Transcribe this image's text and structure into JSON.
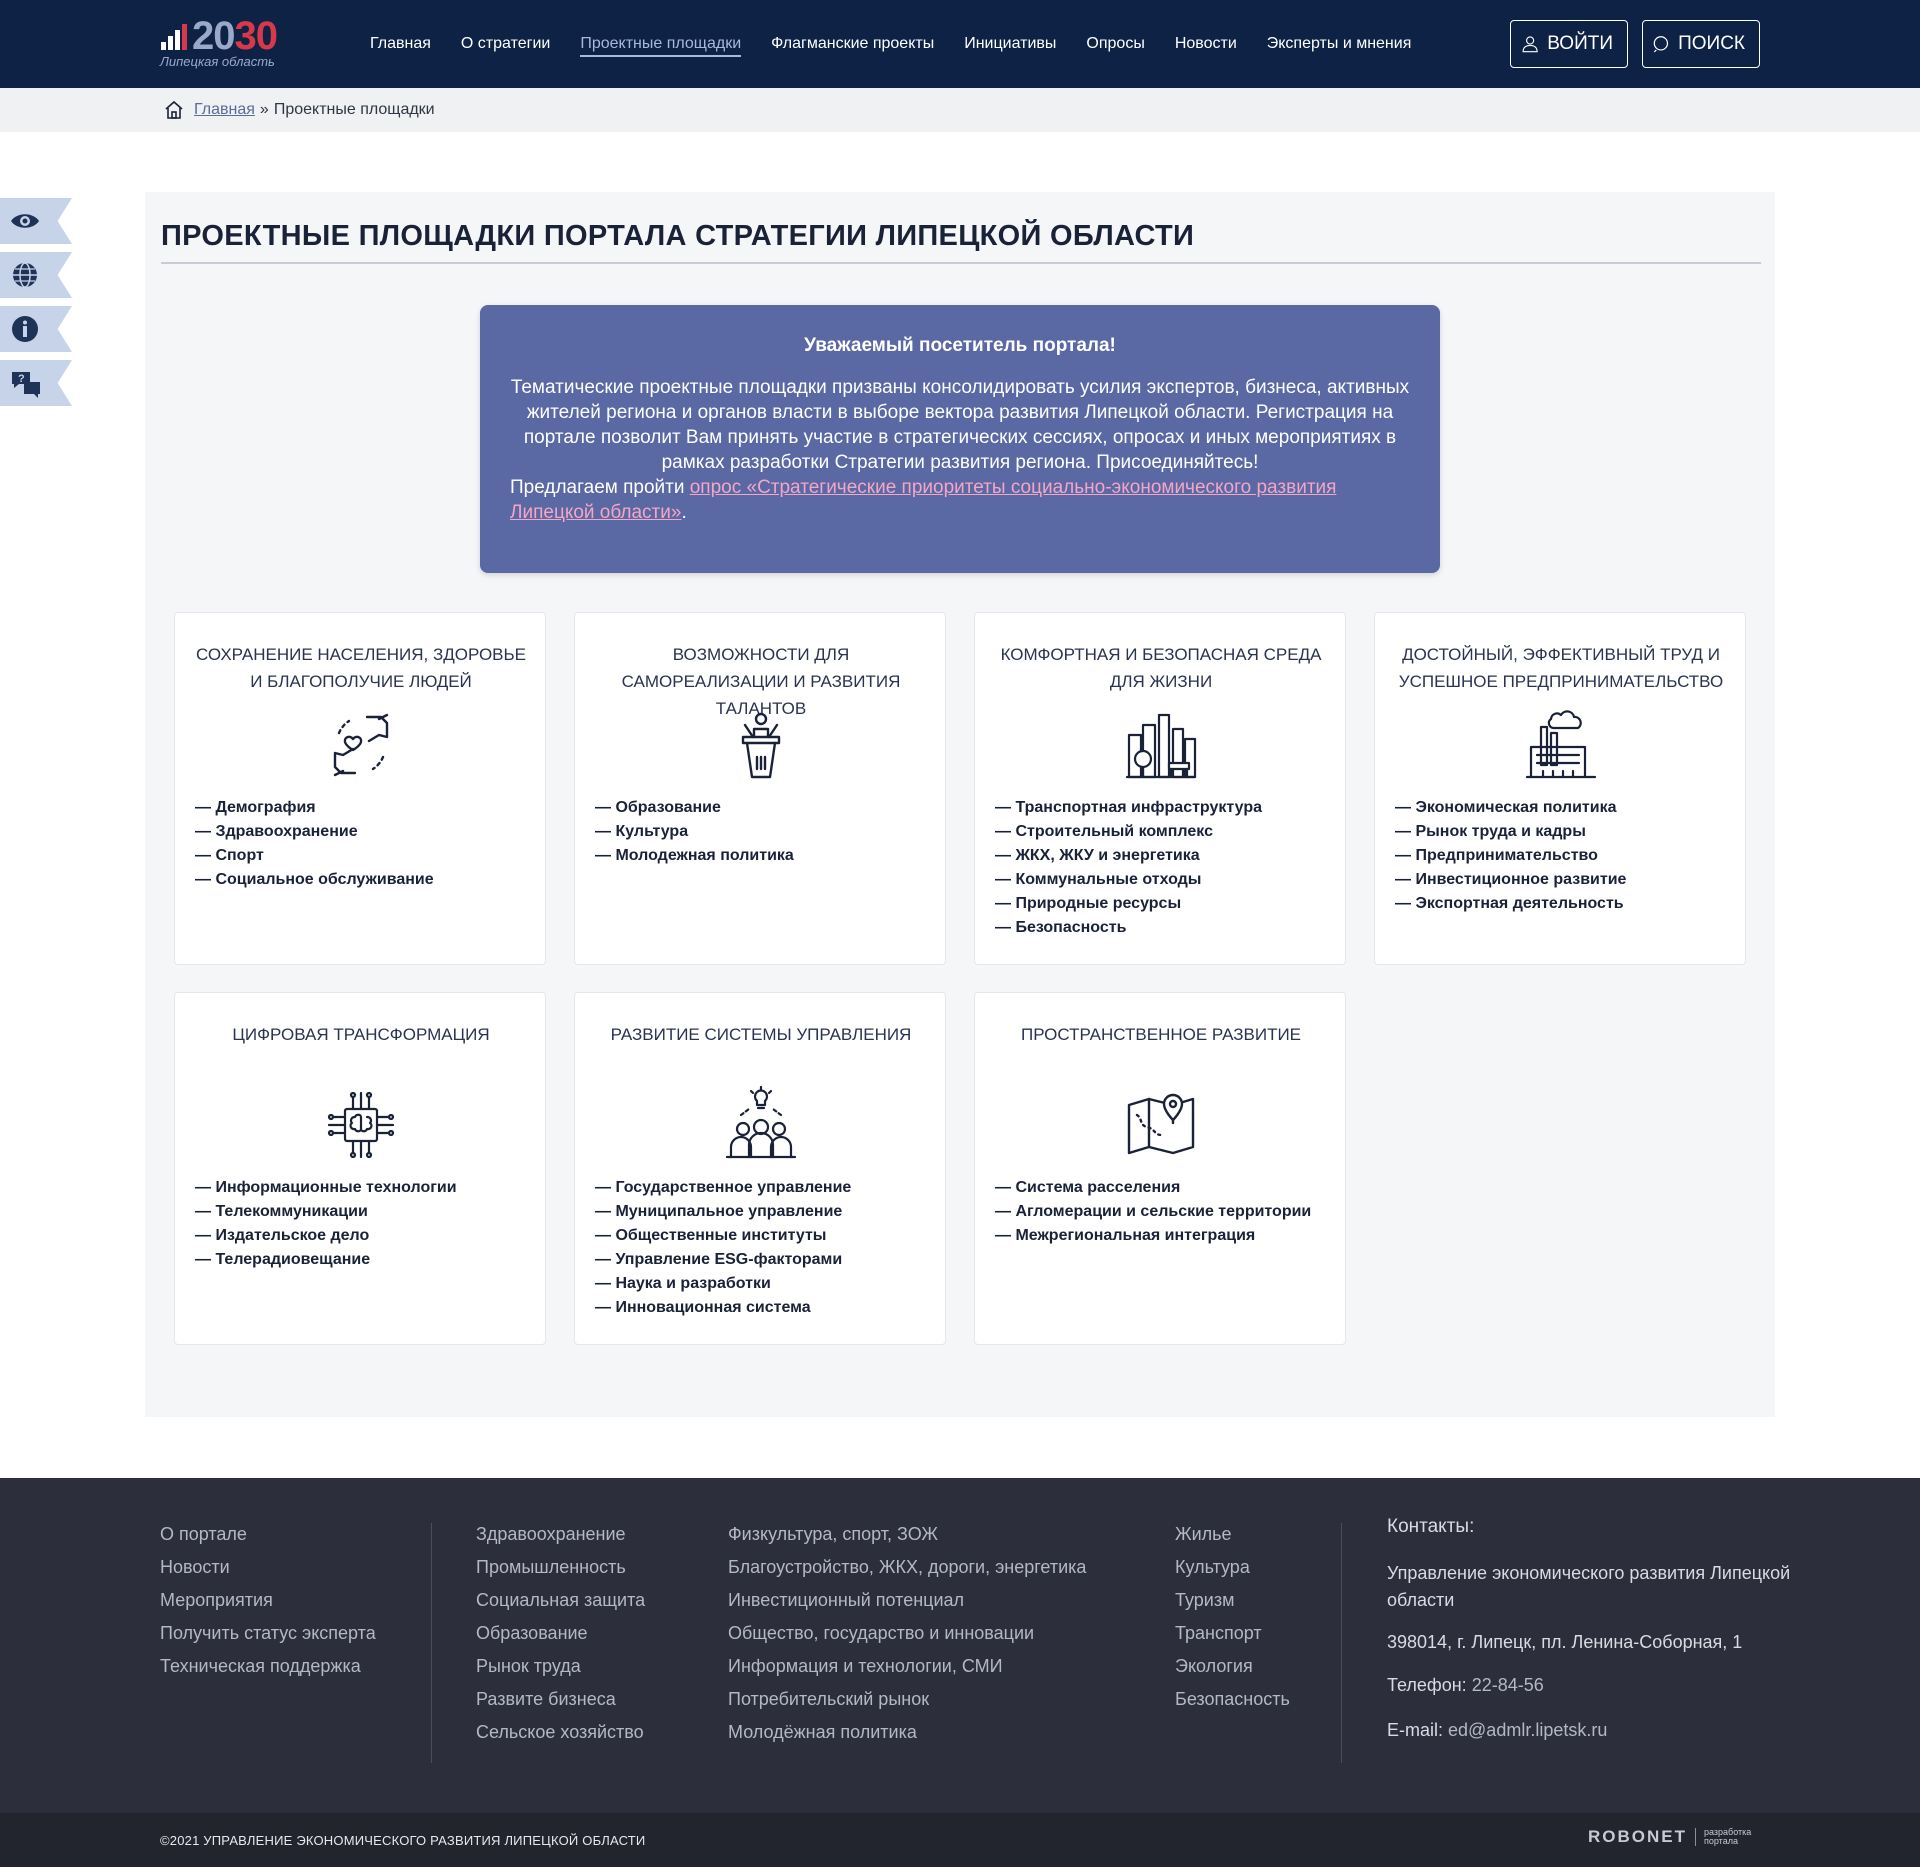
{
  "header": {
    "logo_year_a": "20",
    "logo_year_b": "30",
    "logo_sub": "Липецкая область",
    "nav": [
      {
        "label": "Главная"
      },
      {
        "label": "О стратегии"
      },
      {
        "label": "Проектные площадки"
      },
      {
        "label": "Флагманские проекты"
      },
      {
        "label": "Инициативы"
      },
      {
        "label": "Опросы"
      },
      {
        "label": "Новости"
      },
      {
        "label": "Эксперты и мнения"
      }
    ],
    "active_nav": "Проектные площадки",
    "login_label": "ВОЙТИ",
    "search_label": "ПОИСК"
  },
  "breadcrumb": {
    "home_label": "Главная",
    "separator": "»",
    "current": "Проектные площадки"
  },
  "side_tools": [
    "eye-icon",
    "globe-icon",
    "info-icon",
    "chat-question-icon"
  ],
  "page": {
    "title": "ПРОЕКТНЫЕ ПЛОЩАДКИ ПОРТАЛА СТРАТЕГИИ ЛИПЕЦКОЙ ОБЛАСТИ"
  },
  "notice": {
    "heading": "Уважаемый посетитель портала!",
    "body": "Тематические проектные площадки призваны консолидировать усилия экспертов, бизнеса, активных жителей региона и органов власти в выборе вектора развития Липецкой области. Регистрация на портале позволит Вам принять участие в стратегических сессиях, опросах и иных мероприятиях в рамках разработки Стратегии развития региона. Присоединяйтесь!",
    "cta_prefix": "Предлагаем пройти ",
    "cta_link": "опрос «Стратегические приоритеты социально-экономического развития Липецкой области»",
    "cta_suffix": "."
  },
  "cards": [
    {
      "title": "СОХРАНЕНИЕ НАСЕЛЕНИЯ, ЗДОРОВЬЕ И БЛАГОПОЛУЧИЕ ЛЮДЕЙ",
      "icon": "hands-heart-icon",
      "items": [
        "— Демография",
        "— Здравоохранение",
        "— Спорт",
        "— Социальное обслуживание"
      ]
    },
    {
      "title": "ВОЗМОЖНОСТИ ДЛЯ САМОРЕАЛИЗАЦИИ И РАЗВИТИЯ ТАЛАНТОВ",
      "icon": "speaker-podium-icon",
      "items": [
        "— Образование",
        "— Культура",
        "— Молодежная политика"
      ]
    },
    {
      "title": "КОМФОРТНАЯ И БЕЗОПАСНАЯ СРЕДА ДЛЯ ЖИЗНИ",
      "icon": "city-park-icon",
      "items": [
        "— Транспортная инфраструктура",
        "— Строительный комплекс",
        "— ЖКХ, ЖКУ и энергетика",
        "— Коммунальные отходы",
        "— Природные ресурсы",
        "— Безопасность"
      ]
    },
    {
      "title": "ДОСТОЙНЫЙ, ЭФФЕКТИВНЫЙ ТРУД И УСПЕШНОЕ ПРЕДПРИНИМАТЕЛЬСТВО",
      "icon": "factory-icon",
      "items": [
        "— Экономическая политика",
        "— Рынок труда и кадры",
        "— Предпринимательство",
        "— Инвестиционное развитие",
        "— Экспортная деятельность"
      ]
    },
    {
      "title": "ЦИФРОВАЯ ТРАНСФОРМАЦИЯ",
      "icon": "chip-brain-icon",
      "items": [
        "— Информационные технологии",
        "— Телекоммуникации",
        "— Издательское дело",
        "— Телерадиовещание"
      ]
    },
    {
      "title": "РАЗВИТИЕ СИСТЕМЫ УПРАВЛЕНИЯ",
      "icon": "team-idea-icon",
      "items": [
        "— Государственное управление",
        "— Муниципальное управление",
        "— Общественные институты",
        "— Управление ESG-факторами",
        "— Наука и разработки",
        "— Инновационная система"
      ]
    },
    {
      "title": "ПРОСТРАНСТВЕННОЕ РАЗВИТИЕ",
      "icon": "map-pin-icon",
      "items": [
        "— Система расселения",
        "— Агломерации и сельские территории",
        "— Межрегиональная интеграция"
      ]
    }
  ],
  "footer": {
    "col1": [
      "О портале",
      "Новости",
      "Мероприятия",
      "Получить статус эксперта",
      "Техническая поддержка"
    ],
    "col2": [
      "Здравоохранение",
      "Промышленность",
      "Социальная защита",
      "Образование",
      "Рынок труда",
      "Развите бизнеса",
      "Сельское хозяйство"
    ],
    "col3": [
      "Физкультура, спорт, ЗОЖ",
      "Благоустройство, ЖКХ, дороги, энергетика",
      "Инвестиционный потенциал",
      "Общество, государство и инновации",
      "Информация и технологии, СМИ",
      "Потребительский рынок",
      "Молодёжная политика"
    ],
    "col4": [
      "Жилье",
      "Культура",
      "Туризм",
      "Транспорт",
      "Экология",
      "Безопасность"
    ],
    "contacts": {
      "title": "Контакты:",
      "org": "Управление экономического развития Липецкой области",
      "address": "398014, г. Липецк, пл. Ленина-Соборная, 1",
      "phone_label": "Телефон: ",
      "phone": "22-84-56",
      "email_label": "E-mail: ",
      "email": "ed@admlr.lipetsk.ru"
    },
    "copyright": "©2021 УПРАВЛЕНИЕ ЭКОНОМИЧЕСКОГО РАЗВИТИЯ ЛИПЕЦКОЙ ОБЛАСТИ",
    "developer": "ROBONET",
    "developer_note": "разработка портала"
  },
  "colors": {
    "header_bg": "#0e2246",
    "notice_bg": "#5a68a4",
    "notice_link": "#f4a6c4",
    "footer_bg": "#2c2f3b",
    "accent_red": "#d7394a"
  }
}
